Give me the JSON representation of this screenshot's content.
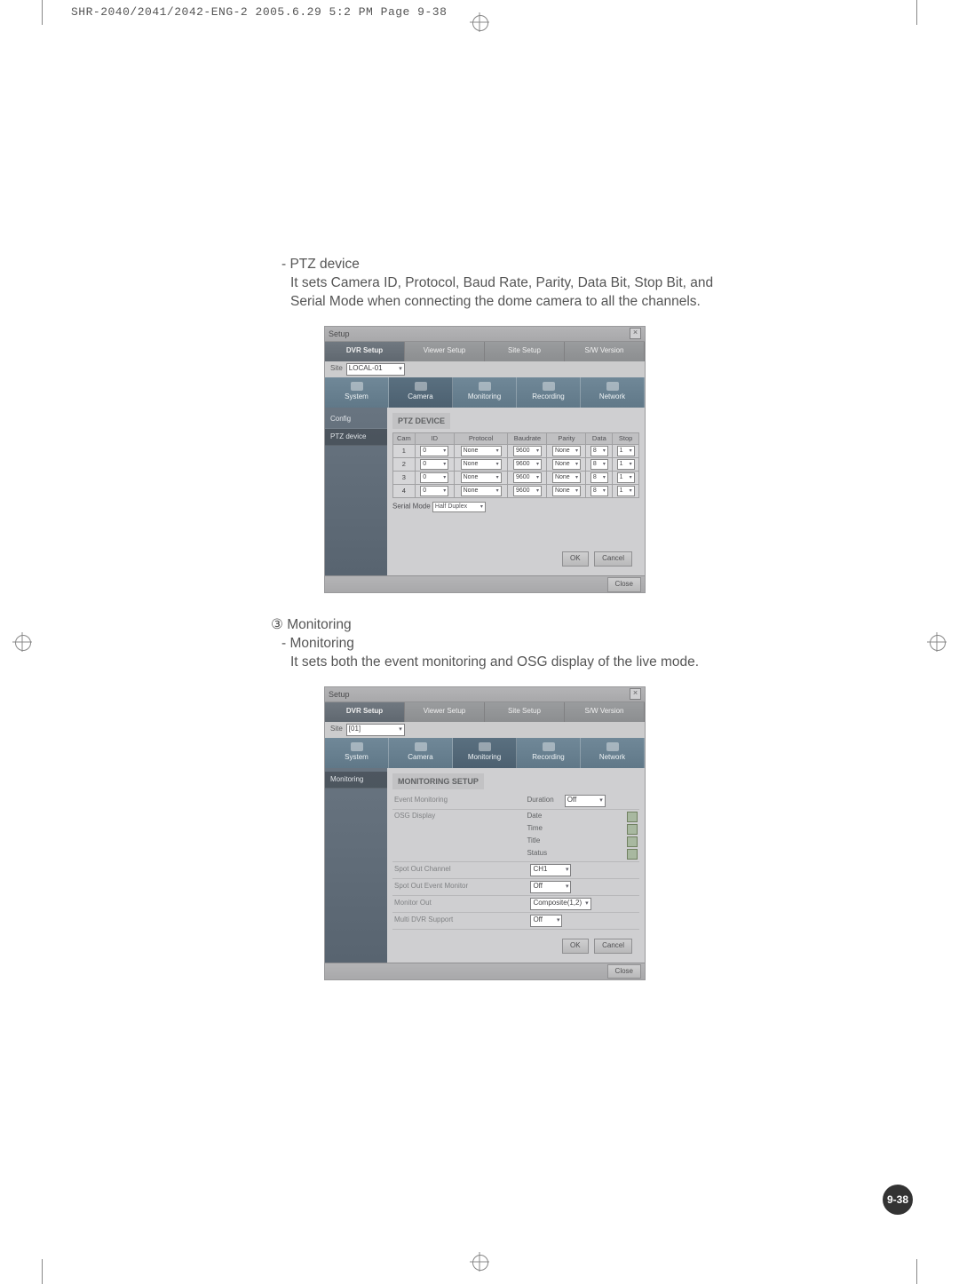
{
  "slug": "SHR-2040/2041/2042-ENG-2  2005.6.29  5:2 PM  Page 9-38",
  "page_number": "9-38",
  "section1": {
    "title": "- PTZ device",
    "body": "It sets Camera ID, Protocol, Baud Rate, Parity, Data Bit, Stop Bit, and Serial Mode when connecting the dome camera to all the channels."
  },
  "section2": {
    "circled": "③ Monitoring",
    "title": "- Monitoring",
    "body": "It sets both the event monitoring and OSG display of the live mode."
  },
  "app_window": {
    "title": "Setup",
    "top_tabs": [
      "DVR Setup",
      "Viewer Setup",
      "Site Setup",
      "S/W Version"
    ],
    "big_tabs": [
      "System",
      "Camera",
      "Monitoring",
      "Recording",
      "Network"
    ],
    "buttons": {
      "ok": "OK",
      "cancel": "Cancel",
      "close": "Close"
    }
  },
  "screenshot_ptz": {
    "site_label": "Site",
    "site_value": "LOCAL-01",
    "side_items": [
      "Config",
      "PTZ device"
    ],
    "panel_title": "PTZ DEVICE",
    "columns": [
      "Cam",
      "ID",
      "Protocol",
      "Baudrate",
      "Parity",
      "Data",
      "Stop"
    ],
    "rows": [
      {
        "cam": "1",
        "id": "0",
        "protocol": "None",
        "baud": "9600",
        "parity": "None",
        "data": "8",
        "stop": "1"
      },
      {
        "cam": "2",
        "id": "0",
        "protocol": "None",
        "baud": "9600",
        "parity": "None",
        "data": "8",
        "stop": "1"
      },
      {
        "cam": "3",
        "id": "0",
        "protocol": "None",
        "baud": "9600",
        "parity": "None",
        "data": "8",
        "stop": "1"
      },
      {
        "cam": "4",
        "id": "0",
        "protocol": "None",
        "baud": "9600",
        "parity": "None",
        "data": "8",
        "stop": "1"
      }
    ],
    "serial_mode_label": "Serial Mode",
    "serial_mode_value": "Half Duplex"
  },
  "screenshot_mon": {
    "site_label": "Site",
    "site_value": "[01]",
    "side_items": [
      "Monitoring"
    ],
    "panel_title": "MONITORING SETUP",
    "rows": {
      "event_monitoring": {
        "label": "Event Monitoring",
        "sub": "Duration",
        "value": "Off"
      },
      "osg_display": {
        "label": "OSG Display",
        "items": [
          {
            "label": "Date",
            "checked": true
          },
          {
            "label": "Time",
            "checked": true
          },
          {
            "label": "Title",
            "checked": true
          },
          {
            "label": "Status",
            "checked": true
          }
        ]
      },
      "spot_channel": {
        "label": "Spot Out Channel",
        "value": "CH1"
      },
      "spot_event": {
        "label": "Spot Out Event Monitor",
        "value": "Off"
      },
      "monitor_out": {
        "label": "Monitor Out",
        "value": "Composite(1,2)"
      },
      "multi_dvr": {
        "label": "Multi DVR Support",
        "value": "Off"
      }
    }
  }
}
